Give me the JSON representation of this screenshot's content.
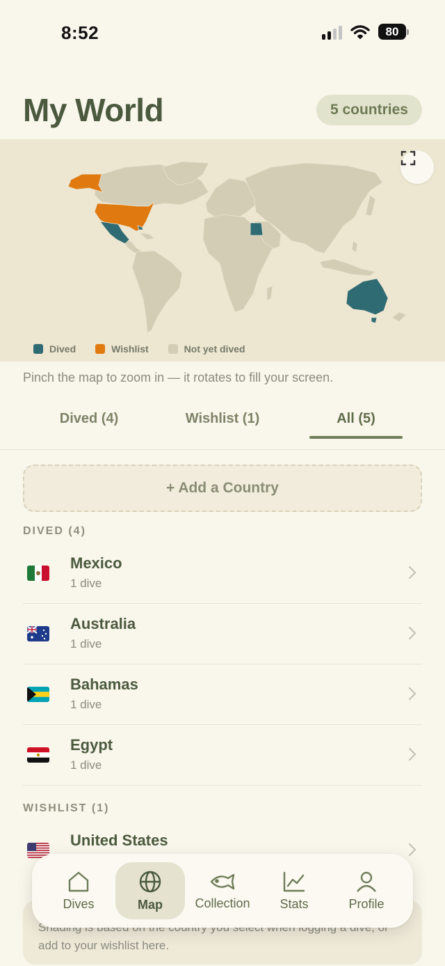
{
  "status": {
    "time": "8:52",
    "battery": "80"
  },
  "header": {
    "title": "My World",
    "count_pill": "5 countries"
  },
  "map": {
    "legend": [
      {
        "label": "Dived",
        "color": "#2f6b72"
      },
      {
        "label": "Wishlist",
        "color": "#e07a10"
      },
      {
        "label": "Not yet dived",
        "color": "#d3cdb6"
      }
    ],
    "expand_icon": "fullscreen-icon"
  },
  "hint": "Pinch the map to zoom in — it rotates to fill your screen.",
  "tabs": {
    "dived": "Dived (4)",
    "wishlist": "Wishlist (1)",
    "all": "All (5)"
  },
  "add_country": "+ Add a Country",
  "sections": {
    "dived": {
      "label": "DIVED (4)",
      "items": [
        {
          "name": "Mexico",
          "sub": "1 dive"
        },
        {
          "name": "Australia",
          "sub": "1 dive"
        },
        {
          "name": "Bahamas",
          "sub": "1 dive"
        },
        {
          "name": "Egypt",
          "sub": "1 dive"
        }
      ]
    },
    "wishlist": {
      "label": "WISHLIST (1)",
      "items": [
        {
          "name": "United States"
        }
      ]
    }
  },
  "shading_note": "Shading is based on the country you select when logging a dive, or add to your wishlist here.",
  "tabbar": [
    {
      "label": "Dives",
      "icon": "home-icon"
    },
    {
      "label": "Map",
      "icon": "globe-icon"
    },
    {
      "label": "Collection",
      "icon": "fish-icon"
    },
    {
      "label": "Stats",
      "icon": "chart-icon"
    },
    {
      "label": "Profile",
      "icon": "person-icon"
    }
  ],
  "colors": {
    "dived": "#2f6b72",
    "wishlist": "#e07a10",
    "land": "#d3cdb6",
    "accent": "#4b5a3e"
  }
}
